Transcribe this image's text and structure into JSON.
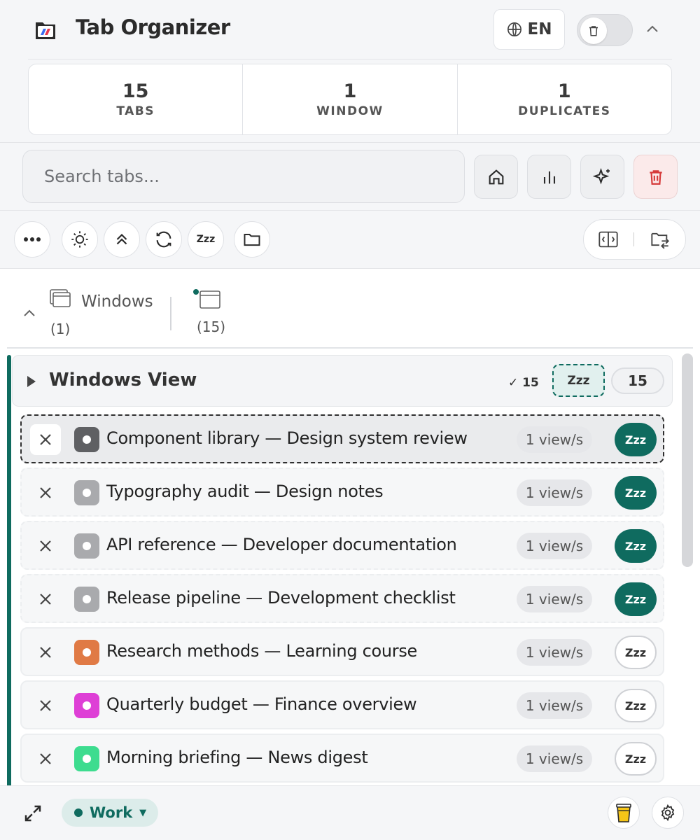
{
  "app": {
    "title": "Tab Organizer"
  },
  "header": {
    "language": "EN",
    "toggle_icon": "trash-icon",
    "collapse_icon": "chevron-up-icon"
  },
  "stats": [
    {
      "value": "15",
      "label": "TABS"
    },
    {
      "value": "1",
      "label": "WINDOW"
    },
    {
      "value": "1",
      "label": "DUPLICATES"
    }
  ],
  "search": {
    "placeholder": "Search tabs...",
    "value": ""
  },
  "actions": [
    "home-icon",
    "bar-chart-icon",
    "sparkles-icon",
    "trash-icon"
  ],
  "toolbar": [
    "more-icon",
    "sun-icon",
    "collapse-all-icon",
    "refresh-icon",
    "sleep-icon",
    "folder-icon"
  ],
  "toolbar_text": {
    "sleep": "Zzz"
  },
  "windows": {
    "label": "Windows",
    "window_count": "(1)",
    "tab_count": "(15)"
  },
  "group": {
    "title": "Windows View",
    "check": "✓ 15",
    "sleep_label": "Zzz",
    "count": "15"
  },
  "tabs": [
    {
      "title": "Component library — Design system review",
      "views": "1 view/s",
      "zzz": "Zzz",
      "color": "#5f6063",
      "sleep_on": true,
      "active": true
    },
    {
      "title": "Typography audit — Design notes",
      "views": "1 view/s",
      "zzz": "Zzz",
      "color": "#a9aaad",
      "sleep_on": true
    },
    {
      "title": "API reference — Developer documentation",
      "views": "1 view/s",
      "zzz": "Zzz",
      "color": "#a9aaad",
      "sleep_on": true
    },
    {
      "title": "Release pipeline — Development checklist",
      "views": "1 view/s",
      "zzz": "Zzz",
      "color": "#a9aaad",
      "sleep_on": true
    },
    {
      "title": "Research methods — Learning course",
      "views": "1 view/s",
      "zzz": "Zzz",
      "color": "#e07a45",
      "sleep_on": false
    },
    {
      "title": "Quarterly budget — Finance overview",
      "views": "1 view/s",
      "zzz": "Zzz",
      "color": "#de3fd6",
      "sleep_on": false
    },
    {
      "title": "Morning briefing — News digest",
      "views": "1 view/s",
      "zzz": "Zzz",
      "color": "#3ddc8f",
      "sleep_on": false
    }
  ],
  "footer": {
    "workspace": "Work"
  },
  "colors": {
    "accent": "#0f6b5f",
    "danger": "#d63a3a"
  }
}
